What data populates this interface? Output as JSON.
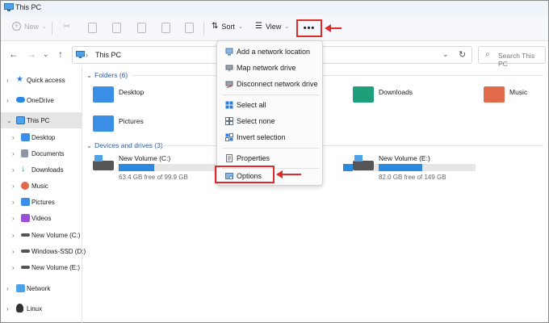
{
  "window": {
    "title": "This PC"
  },
  "toolbar": {
    "new_label": "New",
    "sort_label": "Sort",
    "view_label": "View",
    "more_label": "•••"
  },
  "nav": {
    "breadcrumb": "This PC",
    "search_placeholder": "Search This PC"
  },
  "sidebar": {
    "items": [
      {
        "label": "Quick access",
        "icon": "star-icon"
      },
      {
        "label": "OneDrive",
        "icon": "cloud-icon"
      },
      {
        "label": "This PC",
        "icon": "pc-icon",
        "selected": true
      },
      {
        "label": "Desktop",
        "icon": "desktop-icon"
      },
      {
        "label": "Documents",
        "icon": "documents-icon"
      },
      {
        "label": "Downloads",
        "icon": "downloads-icon"
      },
      {
        "label": "Music",
        "icon": "music-icon"
      },
      {
        "label": "Pictures",
        "icon": "pictures-icon"
      },
      {
        "label": "Videos",
        "icon": "videos-icon"
      },
      {
        "label": "New Volume (C:)",
        "icon": "drive-icon"
      },
      {
        "label": "Windows-SSD (D:)",
        "icon": "drive-icon"
      },
      {
        "label": "New Volume (E:)",
        "icon": "drive-icon"
      },
      {
        "label": "Network",
        "icon": "network-icon"
      },
      {
        "label": "Linux",
        "icon": "linux-icon"
      }
    ]
  },
  "main": {
    "folders_header": "Folders (6)",
    "folders": [
      {
        "label": "Desktop",
        "color": "#3a8ee6"
      },
      {
        "label": "Downloads",
        "color": "#1f9e7a"
      },
      {
        "label": "Music",
        "color": "#e06a4a"
      },
      {
        "label": "Pictures",
        "color": "#3a8ee6"
      }
    ],
    "drives_header": "Devices and drives (3)",
    "drives": [
      {
        "name": "New Volume (C:)",
        "free": "63.4 GB free of 99.9 GB",
        "used_fraction": 0.37
      },
      {
        "name": "New Volume (E:)",
        "free": "82.0 GB free of 149 GB",
        "used_fraction": 0.45
      }
    ],
    "partial_drive_used_fraction": 0.2
  },
  "menu": {
    "items": [
      {
        "label": "Add a network location",
        "icon": "network-location-icon"
      },
      {
        "label": "Map network drive",
        "icon": "map-drive-icon"
      },
      {
        "label": "Disconnect network drive",
        "icon": "disconnect-drive-icon"
      },
      {
        "label": "Select all",
        "icon": "select-all-icon"
      },
      {
        "label": "Select none",
        "icon": "select-none-icon"
      },
      {
        "label": "Invert selection",
        "icon": "invert-selection-icon"
      },
      {
        "label": "Properties",
        "icon": "properties-icon"
      },
      {
        "label": "Options",
        "icon": "options-icon"
      }
    ]
  },
  "colors": {
    "annotation": "#e02b2b",
    "accent": "#2b8ae0"
  }
}
